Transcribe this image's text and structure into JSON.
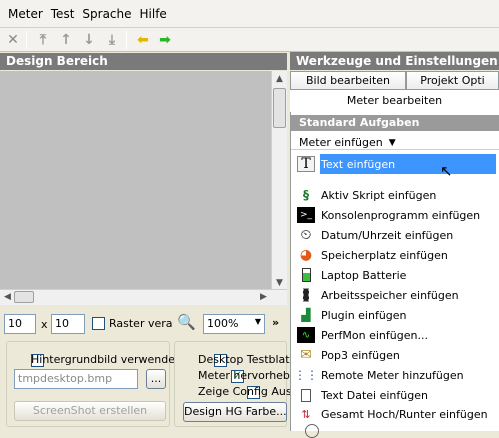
{
  "menu": [
    "Meter",
    "Test",
    "Sprache",
    "Hilfe"
  ],
  "colors": {
    "header_bg": "#7a7a7a",
    "highlight": "#3d95ff",
    "design_bg": "#c0c0c0"
  },
  "left": {
    "title": "Design Bereich",
    "width_value": "10",
    "times": "x",
    "height_value": "10",
    "raster_label": "Raster vera",
    "zoom_value": "100%",
    "background_label": "Hintergrundbild verwende",
    "background_file": "tmpdesktop.bmp",
    "browse_label": "...",
    "screenshot_label": "ScreenShot erstellen",
    "desktop_test_label": "Desktop Testblat",
    "meter_highlight_label": "Meter hervorhebe",
    "show_config_label": "Zeige Config Aus",
    "design_bg_color_label": "Design HG Farbe..."
  },
  "right": {
    "title": "Werkzeuge und Einstellungen",
    "tab_image": "Bild bearbeiten",
    "tab_project": "Projekt Opti",
    "tab_meter": "Meter bearbeiten",
    "section": "Standard Aufgaben",
    "meter_insert": "Meter einfügen",
    "actions": [
      {
        "label": "Text einfügen",
        "icon": "text-T-icon"
      },
      {
        "label": "Aktiv Skript einfügen",
        "icon": "script-icon"
      },
      {
        "label": "Konsolenprogramm einfügen",
        "icon": "console-icon"
      },
      {
        "label": "Datum/Uhrzeit einfügen",
        "icon": "clock-icon"
      },
      {
        "label": "Speicherplatz einfügen",
        "icon": "disk-icon"
      },
      {
        "label": "Laptop Batterie",
        "icon": "battery-icon"
      },
      {
        "label": "Arbeitsspeicher einfügen",
        "icon": "memory-icon"
      },
      {
        "label": "Plugin einfügen",
        "icon": "plugin-icon"
      },
      {
        "label": "PerfMon einfügen...",
        "icon": "perfmon-icon"
      },
      {
        "label": "Pop3 einfügen",
        "icon": "mail-icon"
      },
      {
        "label": "Remote Meter hinzufügen",
        "icon": "remote-icon"
      },
      {
        "label": "Text Datei einfügen",
        "icon": "text-file-icon"
      },
      {
        "label": "Gesamt Hoch/Runter einfügen",
        "icon": "updown-icon"
      }
    ]
  }
}
